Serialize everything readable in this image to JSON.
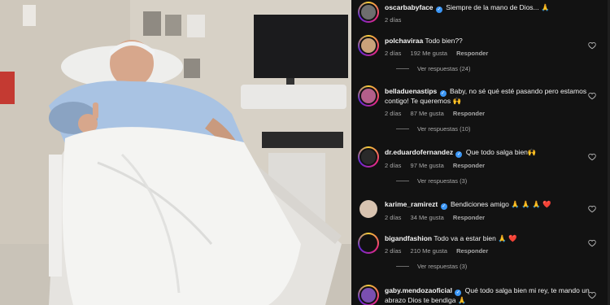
{
  "post": {
    "author": "oscarbabyface",
    "caption": "Siempre de la mano de Dios... 🙏",
    "age": "2 días"
  },
  "comments": [
    {
      "user": "polchaviraa",
      "text": "Todo bien??",
      "age": "2 días",
      "likes": "192 Me gusta",
      "reply": "Responder",
      "view_replies": "Ver respuestas (24)",
      "avatar_color": "#c9a27a"
    },
    {
      "user": "belladuenastips",
      "verified": true,
      "text": "Baby, no sé qué esté pasando pero estamos contigo! Te queremos 🙌",
      "age": "2 días",
      "likes": "87 Me gusta",
      "reply": "Responder",
      "view_replies": "Ver respuestas (10)",
      "avatar_color": "#b45f8a"
    },
    {
      "user": "dr.eduardofernandez",
      "verified": true,
      "text": "Que todo salga bien🙌",
      "age": "2 días",
      "likes": "97 Me gusta",
      "reply": "Responder",
      "view_replies": "Ver respuestas (3)",
      "avatar_color": "#2a2a2a"
    },
    {
      "user": "karime_ramirezt",
      "verified": true,
      "text": "Bendiciones amigo 🙏 🙏 🙏 ❤️",
      "age": "2 días",
      "likes": "34 Me gusta",
      "reply": "Responder",
      "view_replies": "",
      "avatar_color": "#d8c3b0"
    },
    {
      "user": "bigandfashion",
      "text": "Todo va a estar bien 🙏 ❤️",
      "age": "2 días",
      "likes": "210 Me gusta",
      "reply": "Responder",
      "view_replies": "Ver respuestas (3)",
      "avatar_color": "#111111"
    },
    {
      "user": "gaby.mendozaoficial",
      "verified": true,
      "text": "Qué todo salga bien mi rey, te mando un abrazo Dios te bendiga 🙏",
      "age": "",
      "likes": "",
      "reply": "",
      "view_replies": "",
      "avatar_color": "#7a4fb0"
    }
  ],
  "colors": {
    "panel_bg": "#121212",
    "verified": "#3b96f5",
    "muted": "#a8a8a8"
  },
  "icons": {
    "like": "heart-outline-icon"
  }
}
